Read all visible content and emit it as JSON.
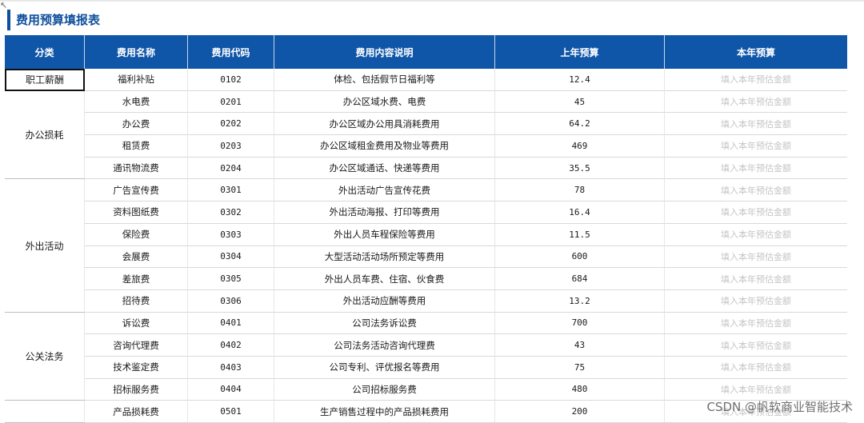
{
  "page": {
    "title": "费用预算填报表",
    "watermark": "CSDN @帆软商业智能技术"
  },
  "columns": [
    "分类",
    "费用名称",
    "费用代码",
    "费用内容说明",
    "上年预算",
    "本年预算"
  ],
  "placeholder": "填入本年预估金额",
  "categories": [
    {
      "label": "职工薪酬",
      "rows": 1
    },
    {
      "label": "办公损耗",
      "rows": 4
    },
    {
      "label": "外出活动",
      "rows": 6
    },
    {
      "label": "公关法务",
      "rows": 4
    },
    {
      "label": "",
      "rows": 1
    }
  ],
  "rows": [
    {
      "name": "福利补贴",
      "code": "0102",
      "desc": "体检、包括假节日福利等",
      "prev": "12.4"
    },
    {
      "name": "水电费",
      "code": "0201",
      "desc": "办公区域水费、电费",
      "prev": "45"
    },
    {
      "name": "办公费",
      "code": "0202",
      "desc": "办公区域办公用具消耗费用",
      "prev": "64.2"
    },
    {
      "name": "租赁费",
      "code": "0203",
      "desc": "办公区域租金费用及物业等费用",
      "prev": "469"
    },
    {
      "name": "通讯物流费",
      "code": "0204",
      "desc": "办公区域通话、快递等费用",
      "prev": "35.5"
    },
    {
      "name": "广告宣传费",
      "code": "0301",
      "desc": "外出活动广告宣传花费",
      "prev": "78"
    },
    {
      "name": "资料图纸费",
      "code": "0302",
      "desc": "外出活动海报、打印等费用",
      "prev": "16.4"
    },
    {
      "name": "保险费",
      "code": "0303",
      "desc": "外出人员车程保险等费用",
      "prev": "11.5"
    },
    {
      "name": "会展费",
      "code": "0304",
      "desc": "大型活动活动场所预定等费用",
      "prev": "600"
    },
    {
      "name": "差旅费",
      "code": "0305",
      "desc": "外出人员车费、住宿、伙食费",
      "prev": "684"
    },
    {
      "name": "招待费",
      "code": "0306",
      "desc": "外出活动应酬等费用",
      "prev": "13.2"
    },
    {
      "name": "诉讼费",
      "code": "0401",
      "desc": "公司法务诉讼费",
      "prev": "700"
    },
    {
      "name": "咨询代理费",
      "code": "0402",
      "desc": "公司法务活动咨询代理费",
      "prev": "43"
    },
    {
      "name": "技术鉴定费",
      "code": "0403",
      "desc": "公司专利、评优报名等费用",
      "prev": "75"
    },
    {
      "name": "招标服务费",
      "code": "0404",
      "desc": "公司招标服务费",
      "prev": "480"
    },
    {
      "name": "产品损耗费",
      "code": "0501",
      "desc": "生产销售过程中的产品损耗费用",
      "prev": "200"
    }
  ]
}
